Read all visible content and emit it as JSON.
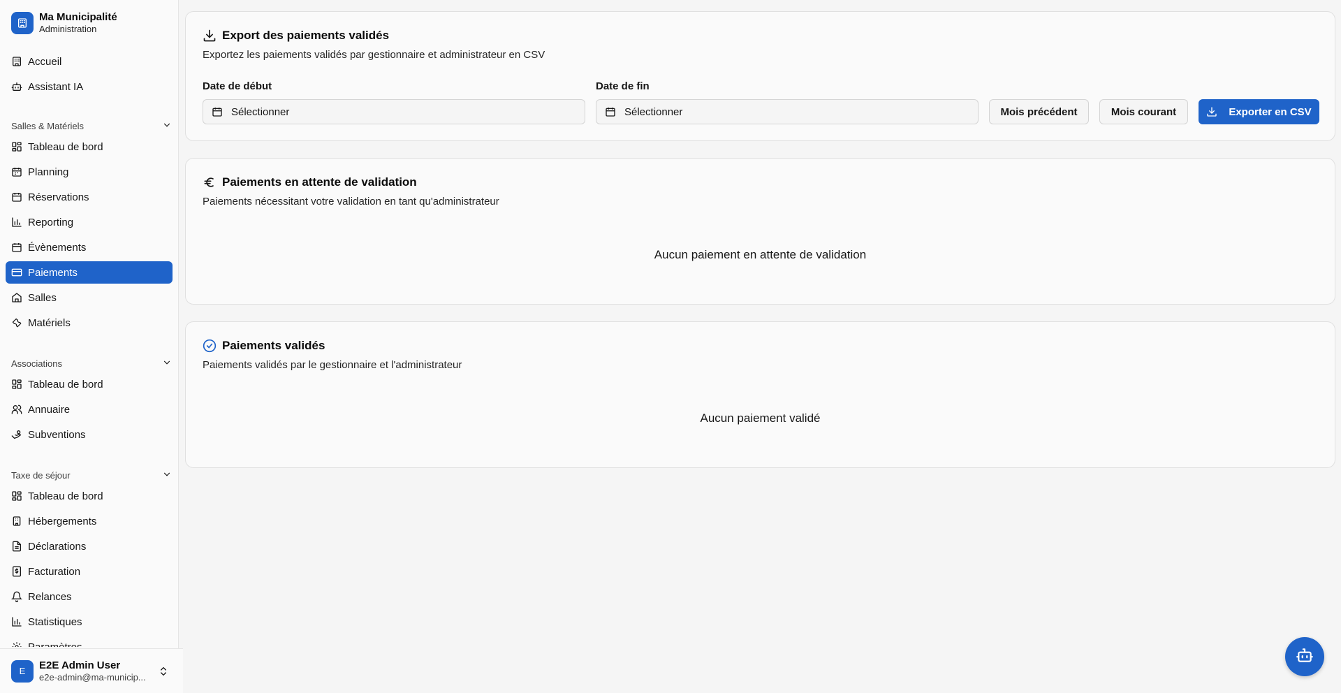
{
  "brand": {
    "title": "Ma Municipalité",
    "subtitle": "Administration",
    "icon": "building-icon"
  },
  "nav": {
    "top": [
      {
        "label": "Accueil",
        "icon": "building-icon"
      },
      {
        "label": "Assistant IA",
        "icon": "bot-icon"
      }
    ],
    "groups": [
      {
        "label": "Salles & Matériels",
        "items": [
          {
            "label": "Tableau de bord",
            "icon": "dashboard-icon"
          },
          {
            "label": "Planning",
            "icon": "calendar-icon"
          },
          {
            "label": "Réservations",
            "icon": "calendar-icon"
          },
          {
            "label": "Reporting",
            "icon": "bar-chart-icon"
          },
          {
            "label": "Évènements",
            "icon": "calendar-icon"
          },
          {
            "label": "Paiements",
            "icon": "credit-card-icon",
            "active": true
          },
          {
            "label": "Salles",
            "icon": "home-icon"
          },
          {
            "label": "Matériels",
            "icon": "wrench-icon"
          }
        ]
      },
      {
        "label": "Associations",
        "items": [
          {
            "label": "Tableau de bord",
            "icon": "dashboard-icon"
          },
          {
            "label": "Annuaire",
            "icon": "users-icon"
          },
          {
            "label": "Subventions",
            "icon": "hand-coins-icon"
          }
        ]
      },
      {
        "label": "Taxe de séjour",
        "items": [
          {
            "label": "Tableau de bord",
            "icon": "dashboard-icon"
          },
          {
            "label": "Hébergements",
            "icon": "building-icon"
          },
          {
            "label": "Déclarations",
            "icon": "file-icon"
          },
          {
            "label": "Facturation",
            "icon": "receipt-icon"
          },
          {
            "label": "Relances",
            "icon": "bell-icon"
          },
          {
            "label": "Statistiques",
            "icon": "bar-chart-icon"
          },
          {
            "label": "Paramètres",
            "icon": "gear-icon"
          }
        ]
      }
    ]
  },
  "user": {
    "initial": "E",
    "name": "E2E Admin User",
    "email": "e2e-admin@ma-municip..."
  },
  "export": {
    "title": "Export des paiements validés",
    "description": "Exportez les paiements validés par gestionnaire et administrateur en CSV",
    "start_label": "Date de début",
    "end_label": "Date de fin",
    "start_value": "Sélectionner",
    "end_value": "Sélectionner",
    "prev_month": "Mois précédent",
    "current_month": "Mois courant",
    "export_button": "Exporter en CSV"
  },
  "pending": {
    "title": "Paiements en attente de validation",
    "description": "Paiements nécessitant votre validation en tant qu'administrateur",
    "empty": "Aucun paiement en attente de validation"
  },
  "validated": {
    "title": "Paiements validés",
    "description": "Paiements validés par le gestionnaire et l'administrateur",
    "empty": "Aucun paiement validé"
  },
  "colors": {
    "accent": "#1f63c9",
    "background": "#f5f5f5",
    "card": "#fafafa"
  }
}
